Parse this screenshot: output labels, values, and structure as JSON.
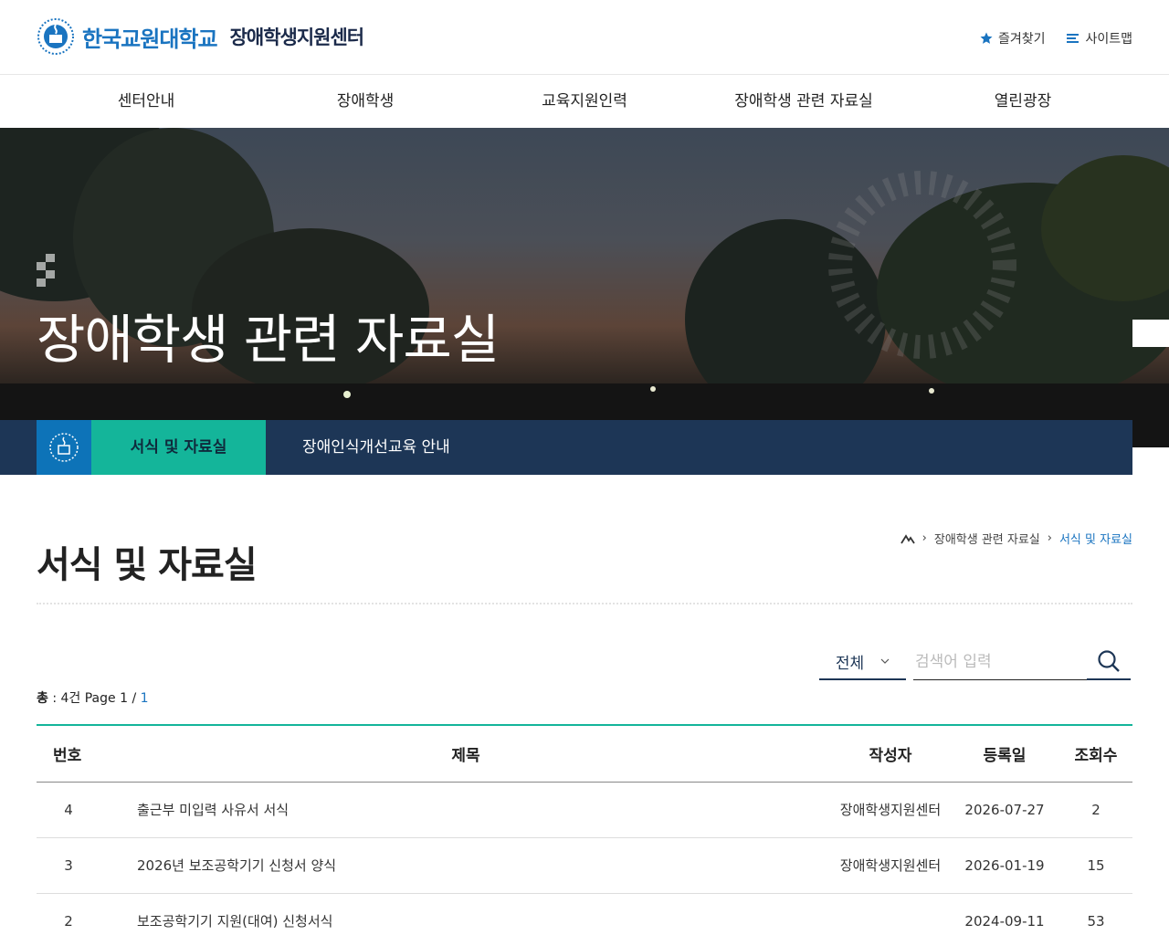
{
  "header": {
    "university": "한국교원대학교",
    "center": "장애학생지원센터",
    "bookmark_label": "즐겨찾기",
    "sitemap_label": "사이트맵"
  },
  "gnb": [
    "센터안내",
    "장애학생",
    "교육지원인력",
    "장애학생 관련 자료실",
    "열린광장"
  ],
  "visual": {
    "title": "장애학생 관련 자료실"
  },
  "subnav": {
    "tabs": [
      "서식 및 자료실",
      "장애인식개선교육 안내"
    ]
  },
  "page": {
    "title": "서식 및 자료실",
    "breadcrumb": [
      "장애학생 관련 자료실",
      "서식 및 자료실"
    ]
  },
  "search": {
    "select_value": "전체",
    "placeholder": "검색어 입력"
  },
  "total": {
    "label": "총",
    "count_text": ": 4건 Page 1 /",
    "page_link": "1"
  },
  "board": {
    "headers": [
      "번호",
      "제목",
      "작성자",
      "등록일",
      "조회수"
    ],
    "rows": [
      {
        "no": "4",
        "title": "출근부 미입력 사유서 서식",
        "author": "장애학생지원센터",
        "date": "2026-07-27",
        "views": "2"
      },
      {
        "no": "3",
        "title": "2026년 보조공학기기 신청서 양식",
        "author": "장애학생지원센터",
        "date": "2026-01-19",
        "views": "15"
      },
      {
        "no": "2",
        "title": "보조공학기기 지원(대여) 신청서식",
        "author": "",
        "date": "2024-09-11",
        "views": "53"
      }
    ]
  },
  "colors": {
    "brand_blue": "#1a74c0",
    "navy": "#1d3656",
    "teal": "#14b59a"
  }
}
